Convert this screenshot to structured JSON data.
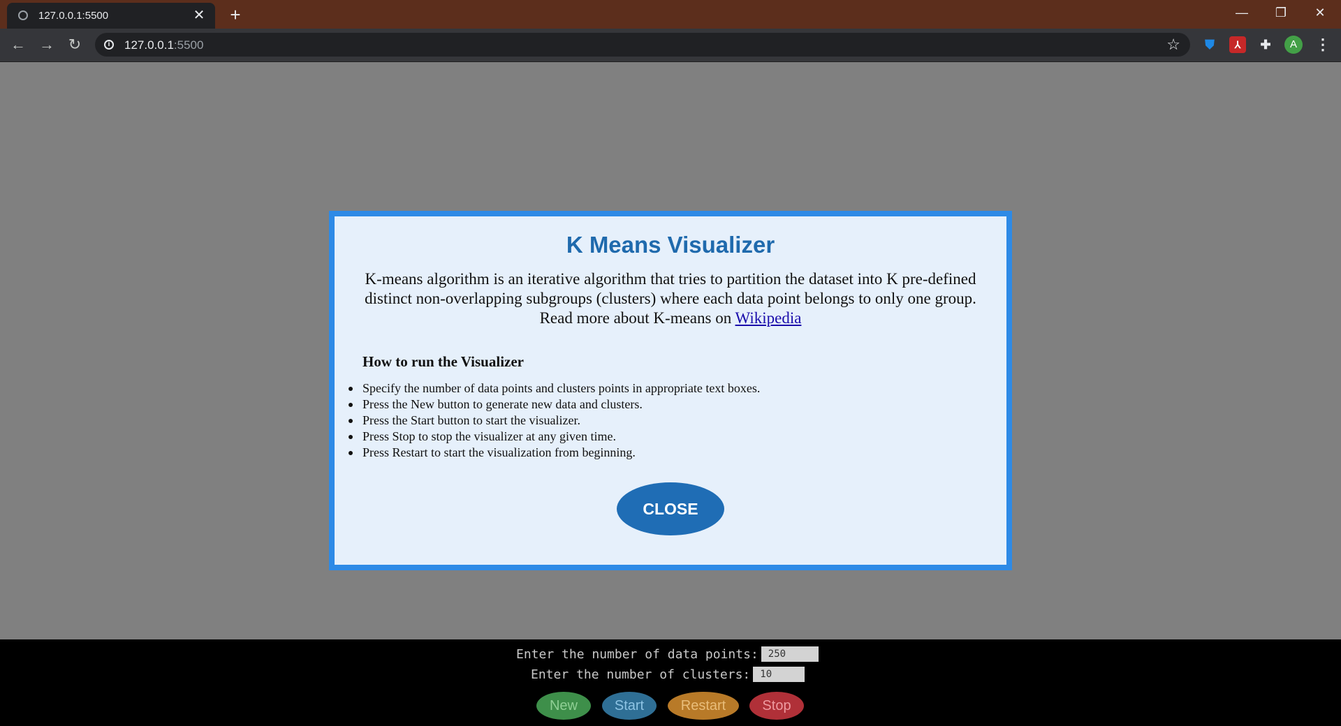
{
  "browser": {
    "tab_title": "127.0.0.1:5500",
    "tab_close": "✕",
    "new_tab": "+",
    "url_host": "127.0.0.1",
    "url_port": ":5500",
    "avatar_letter": "A",
    "window_controls": {
      "minimize": "—",
      "restore": "❐",
      "close": "✕"
    }
  },
  "modal": {
    "title": "K Means Visualizer",
    "description": "K-means algorithm is an iterative algorithm that tries to partition the dataset into K pre-defined distinct non-overlapping subgroups (clusters) where each data point belongs to only one group. Read more about K-means on ",
    "link_text": "Wikipedia",
    "howto_title": "How to run the Visualizer",
    "steps": [
      "Specify the number of data points and clusters points in appropriate text boxes.",
      "Press the New button to generate new data and clusters.",
      "Press the Start button to start the visualizer.",
      "Press Stop to stop the visualizer at any given time.",
      "Press Restart to start the visualization from beginning."
    ],
    "close_label": "CLOSE"
  },
  "controls": {
    "points_label": "Enter the number of data points:",
    "points_value": "250",
    "clusters_label": "Enter the number of clusters:",
    "clusters_value": "10",
    "buttons": {
      "new": "New",
      "start": "Start",
      "restart": "Restart",
      "stop": "Stop"
    }
  },
  "colors": {
    "tabbar": "#5c2e1c",
    "modal_border": "#2e8ae6",
    "modal_bg": "#e6f0fb",
    "title_blue": "#1f6aad",
    "new_button": "#3e8f4a",
    "start_button": "#2f6f95",
    "restart_button": "#b87a28",
    "stop_button": "#b03038"
  }
}
